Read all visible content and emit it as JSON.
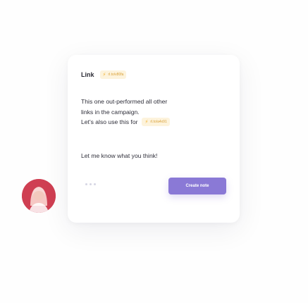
{
  "link": {
    "label": "Link",
    "url": "rl.to/v80fa"
  },
  "message": {
    "line1": "This one out-performed all other",
    "line2": "links in the campaign.",
    "line3": "Let's also use this for",
    "inline_url": "rl.to/a4x91",
    "closing": "Let me know what you think!"
  },
  "actions": {
    "create_note_label": "Create note"
  },
  "colors": {
    "accent": "#8a79d6",
    "chip_bg": "#fdf3dc",
    "chip_text": "#d9a13a",
    "avatar_bg": "#cf3f52"
  },
  "icons": {
    "chip_icon": "lightning-icon",
    "avatar": "user-avatar",
    "typing": "typing-dots-icon"
  }
}
